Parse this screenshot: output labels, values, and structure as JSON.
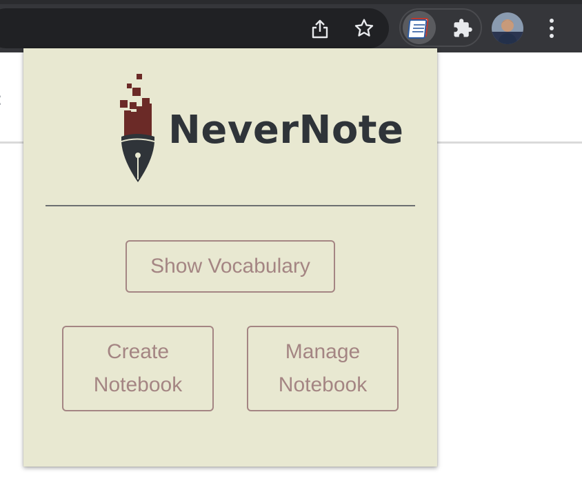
{
  "browser": {
    "icons": {
      "share": "share-icon",
      "bookmark": "star-icon",
      "extension_active": "notebook-extension-icon",
      "extensions": "puzzle-icon",
      "profile": "avatar",
      "menu": "more-vert-icon"
    }
  },
  "popup": {
    "brand_name": "NeverNote",
    "buttons": {
      "show_vocabulary": "Show Vocabulary",
      "create_notebook": "Create Notebook",
      "manage_notebook": "Manage Notebook"
    }
  },
  "colors": {
    "popup_bg": "#e8e8d1",
    "brand_text": "#2f3439",
    "button": "#a48583",
    "logo_red": "#6b2a27",
    "logo_dark": "#2f3439",
    "toolbar": "#35363a"
  }
}
